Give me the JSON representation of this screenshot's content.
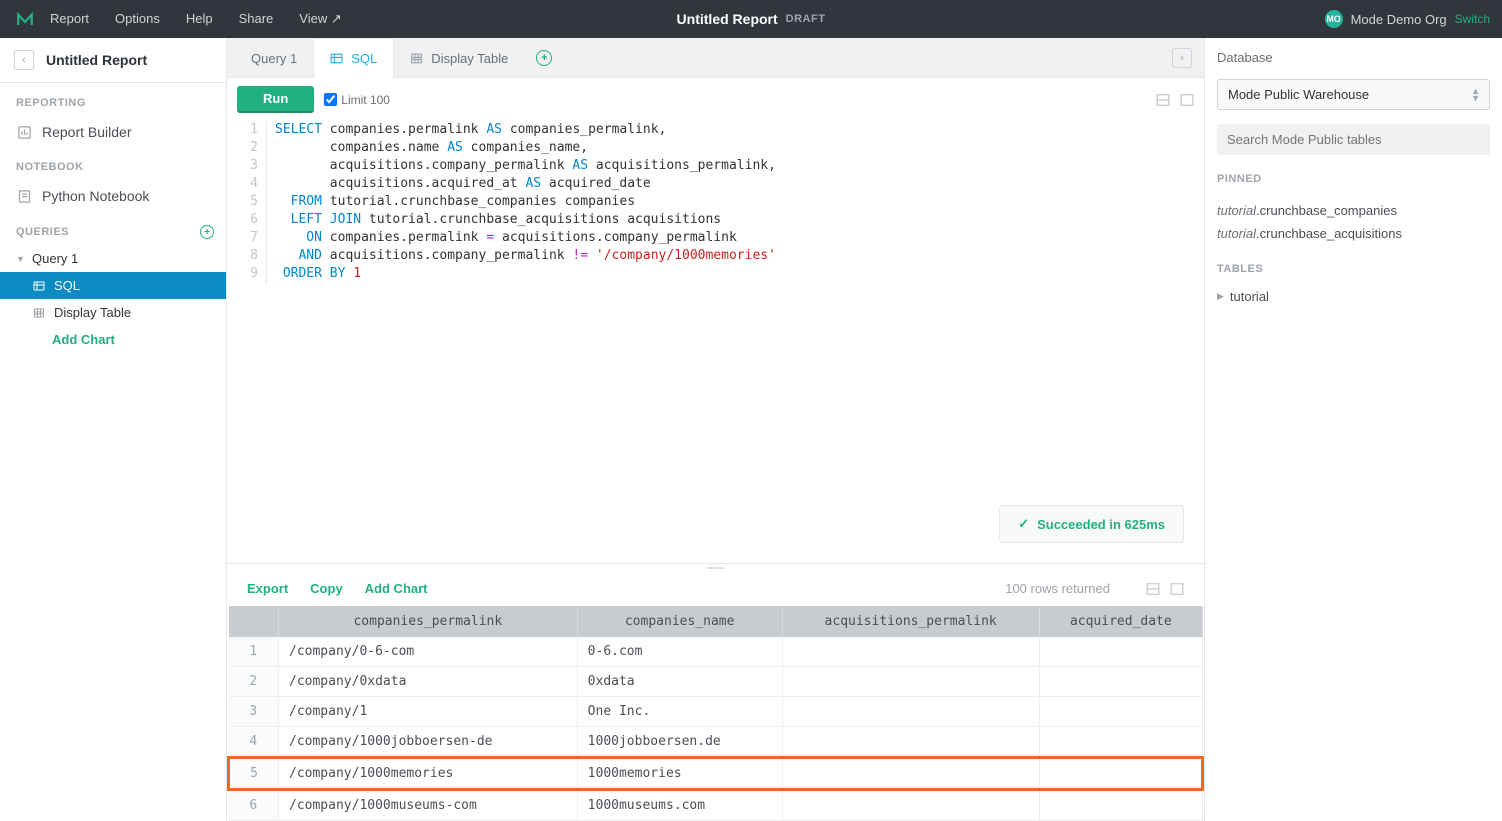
{
  "topbar": {
    "menu": [
      "Report",
      "Options",
      "Help",
      "Share",
      "View ↗"
    ],
    "title": "Untitled Report",
    "status": "DRAFT",
    "org_badge": "MO",
    "org_name": "Mode Demo Org",
    "switch": "Switch"
  },
  "sidebar": {
    "report_name": "Untitled Report",
    "section_reporting": "REPORTING",
    "report_builder": "Report Builder",
    "section_notebook": "NOTEBOOK",
    "python_notebook": "Python Notebook",
    "section_queries": "QUERIES",
    "query1": "Query 1",
    "sql": "SQL",
    "display_table": "Display Table",
    "add_chart": "Add Chart"
  },
  "tabs": {
    "query1": "Query 1",
    "sql": "SQL",
    "display_table": "Display Table"
  },
  "editor": {
    "run": "Run",
    "limit": "Limit 100",
    "lines": [
      "1",
      "2",
      "3",
      "4",
      "5",
      "6",
      "7",
      "8",
      "9"
    ],
    "status": "Succeeded in 625ms"
  },
  "results": {
    "export": "Export",
    "copy": "Copy",
    "add_chart": "Add Chart",
    "rows_returned": "100 rows returned",
    "columns": [
      "companies_permalink",
      "companies_name",
      "acquisitions_permalink",
      "acquired_date"
    ],
    "rows": [
      {
        "n": "1",
        "c0": "/company/0-6-com",
        "c1": "0-6.com",
        "c2": "",
        "c3": ""
      },
      {
        "n": "2",
        "c0": "/company/0xdata",
        "c1": "0xdata",
        "c2": "",
        "c3": ""
      },
      {
        "n": "3",
        "c0": "/company/1",
        "c1": "One Inc.",
        "c2": "",
        "c3": ""
      },
      {
        "n": "4",
        "c0": "/company/1000jobboersen-de",
        "c1": "1000jobboersen.de",
        "c2": "",
        "c3": ""
      },
      {
        "n": "5",
        "c0": "/company/1000memories",
        "c1": "1000memories",
        "c2": "",
        "c3": "",
        "hl": true
      },
      {
        "n": "6",
        "c0": "/company/1000museums-com",
        "c1": "1000museums.com",
        "c2": "",
        "c3": ""
      }
    ]
  },
  "right": {
    "database_label": "Database",
    "database_value": "Mode Public Warehouse",
    "search_placeholder": "Search Mode Public tables",
    "pinned": "PINNED",
    "pinned_items": [
      {
        "schema": "tutorial",
        "table": ".crunchbase_companies"
      },
      {
        "schema": "tutorial",
        "table": ".crunchbase_acquisitions"
      }
    ],
    "tables": "TABLES",
    "tutorial": "tutorial"
  },
  "sql": {
    "l1a": "SELECT",
    "l1b": " companies.permalink ",
    "l1c": "AS",
    "l1d": " companies_permalink,",
    "l2a": "       companies.name ",
    "l2b": "AS",
    "l2c": " companies_name,",
    "l3a": "       acquisitions.company_permalink ",
    "l3b": "AS",
    "l3c": " acquisitions_permalink,",
    "l4a": "       acquisitions.acquired_at ",
    "l4b": "AS",
    "l4c": " acquired_date",
    "l5a": "  FROM",
    "l5b": " tutorial.crunchbase_companies companies",
    "l6a": "  LEFT JOIN",
    "l6b": " tutorial.crunchbase_acquisitions acquisitions",
    "l7a": "    ON",
    "l7b": " companies.permalink ",
    "l7c": "=",
    "l7d": " acquisitions.company_permalink",
    "l8a": "   AND",
    "l8b": " acquisitions.company_permalink ",
    "l8c": "!=",
    "l8d": " ",
    "l8e": "'/company/1000memories'",
    "l9a": " ORDER BY ",
    "l9b": "1"
  }
}
